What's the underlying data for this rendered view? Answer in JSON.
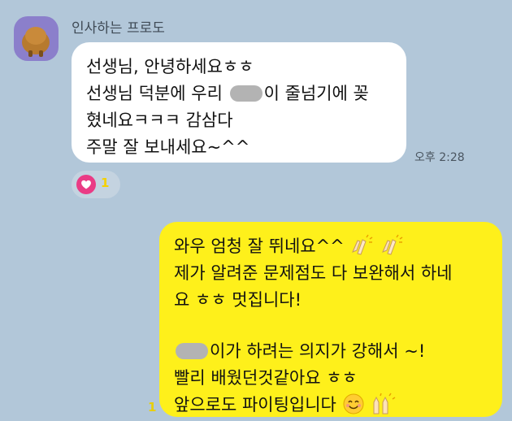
{
  "chat": {
    "sender_name": "인사하는 프로도",
    "incoming": {
      "line1": "선생님, 안녕하세요ㅎㅎ",
      "line2_a": "선생님 덕분에 우리 ",
      "line2_b": "이 줄넘기에 꽂",
      "line3": "혔네요ㅋㅋㅋ 감삼다",
      "line4": "주말 잘 보내세요~^^",
      "time": "오후 2:28",
      "reaction_count": "1"
    },
    "outgoing": {
      "line1": "와우 엄청 잘 뛰네요^^",
      "line2": "제가 알려준 문제점도 다 보완해서 하네",
      "line3": "요 ㅎㅎ 멋집니다!",
      "line5_b": "이가 하려는 의지가 강해서 ~!",
      "line6": "빨리 배웠던것같아요 ㅎㅎ",
      "line7": "앞으로도 파이팅입니다",
      "unread_count": "1"
    }
  },
  "icons": {
    "avatar": "frodo-avatar",
    "reaction": "heart-icon",
    "emoji_clap": "clapping-hands-icon",
    "emoji_smile": "smiling-face-icon",
    "emoji_raise": "raising-hands-icon"
  },
  "colors": {
    "background": "#b2c7d9",
    "incoming_bubble": "#ffffff",
    "outgoing_bubble": "#fef01b",
    "reaction_heart": "#ea3b85",
    "unread": "#e8cf00"
  }
}
